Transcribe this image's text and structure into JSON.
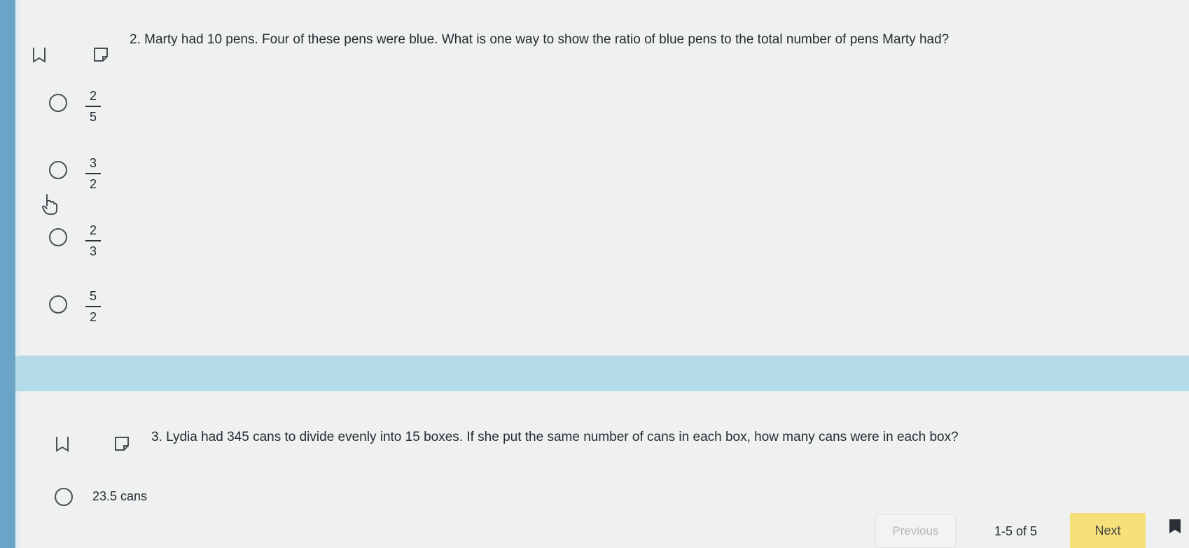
{
  "q2": {
    "text": "2. Marty had 10 pens. Four of these pens were blue. What is one way to show the ratio of blue pens to the total number of pens Marty had?",
    "options": [
      {
        "num": "2",
        "den": "5"
      },
      {
        "num": "3",
        "den": "2"
      },
      {
        "num": "2",
        "den": "3"
      },
      {
        "num": "5",
        "den": "2"
      }
    ]
  },
  "q3": {
    "text": "3. Lydia had 345 cans to divide evenly into 15 boxes. If she put the same number of cans in each box, how many cans were in each box?",
    "options": [
      {
        "label": "23.5 cans"
      }
    ]
  },
  "nav": {
    "previous": "Previous",
    "count": "1-5 of 5",
    "next": "Next"
  },
  "icons": [
    "bookmark-icon",
    "note-icon",
    "pointer-hand-icon"
  ],
  "colors": {
    "next_button": "#f6e07a",
    "separator": "#b4dbe8"
  }
}
